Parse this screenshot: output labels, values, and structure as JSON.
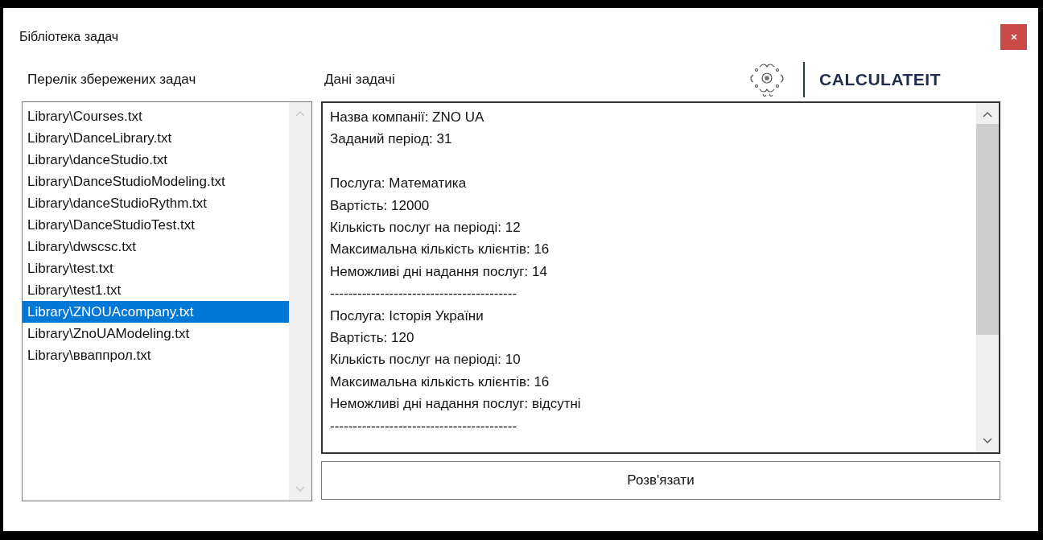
{
  "window": {
    "title": "Бібліотека задач"
  },
  "list_panel": {
    "label": "Перелік збережених задач",
    "items": [
      {
        "text": "Library\\Courses.txt",
        "selected": false
      },
      {
        "text": "Library\\DanceLibrary.txt",
        "selected": false
      },
      {
        "text": "Library\\danceStudio.txt",
        "selected": false
      },
      {
        "text": "Library\\DanceStudioModeling.txt",
        "selected": false
      },
      {
        "text": "Library\\danceStudioRythm.txt",
        "selected": false
      },
      {
        "text": "Library\\DanceStudioTest.txt",
        "selected": false
      },
      {
        "text": "Library\\dwscsc.txt",
        "selected": false
      },
      {
        "text": "Library\\test.txt",
        "selected": false
      },
      {
        "text": "Library\\test1.txt",
        "selected": false
      },
      {
        "text": "Library\\ZNOUAcompany.txt",
        "selected": true
      },
      {
        "text": "Library\\ZnoUAModeling.txt",
        "selected": false
      },
      {
        "text": "Library\\вваппрол.txt",
        "selected": false
      }
    ]
  },
  "details_panel": {
    "label": "Дані задачі",
    "brand": "CALCULATEIT",
    "company": [
      "Назва компанії: ZNO UA",
      "Заданий період: 31"
    ],
    "services": [
      {
        "lines": [
          "Послуга: Математика",
          "Вартість: 12000",
          "Кількість послуг на періоді: 12",
          "Максимальна кількість клієнтів: 16",
          "Неможливі дні надання послуг: 14"
        ],
        "separator": "-----------------------------------------"
      },
      {
        "lines": [
          "Послуга: Історія України",
          "Вартість: 120",
          "Кількість послуг на періоді: 10",
          "Максимальна кількість клієнтів: 16",
          "Неможливі дні надання послуг: відсутні"
        ],
        "separator": "-----------------------------------------"
      }
    ]
  },
  "solve_button": "Розв'язати"
}
